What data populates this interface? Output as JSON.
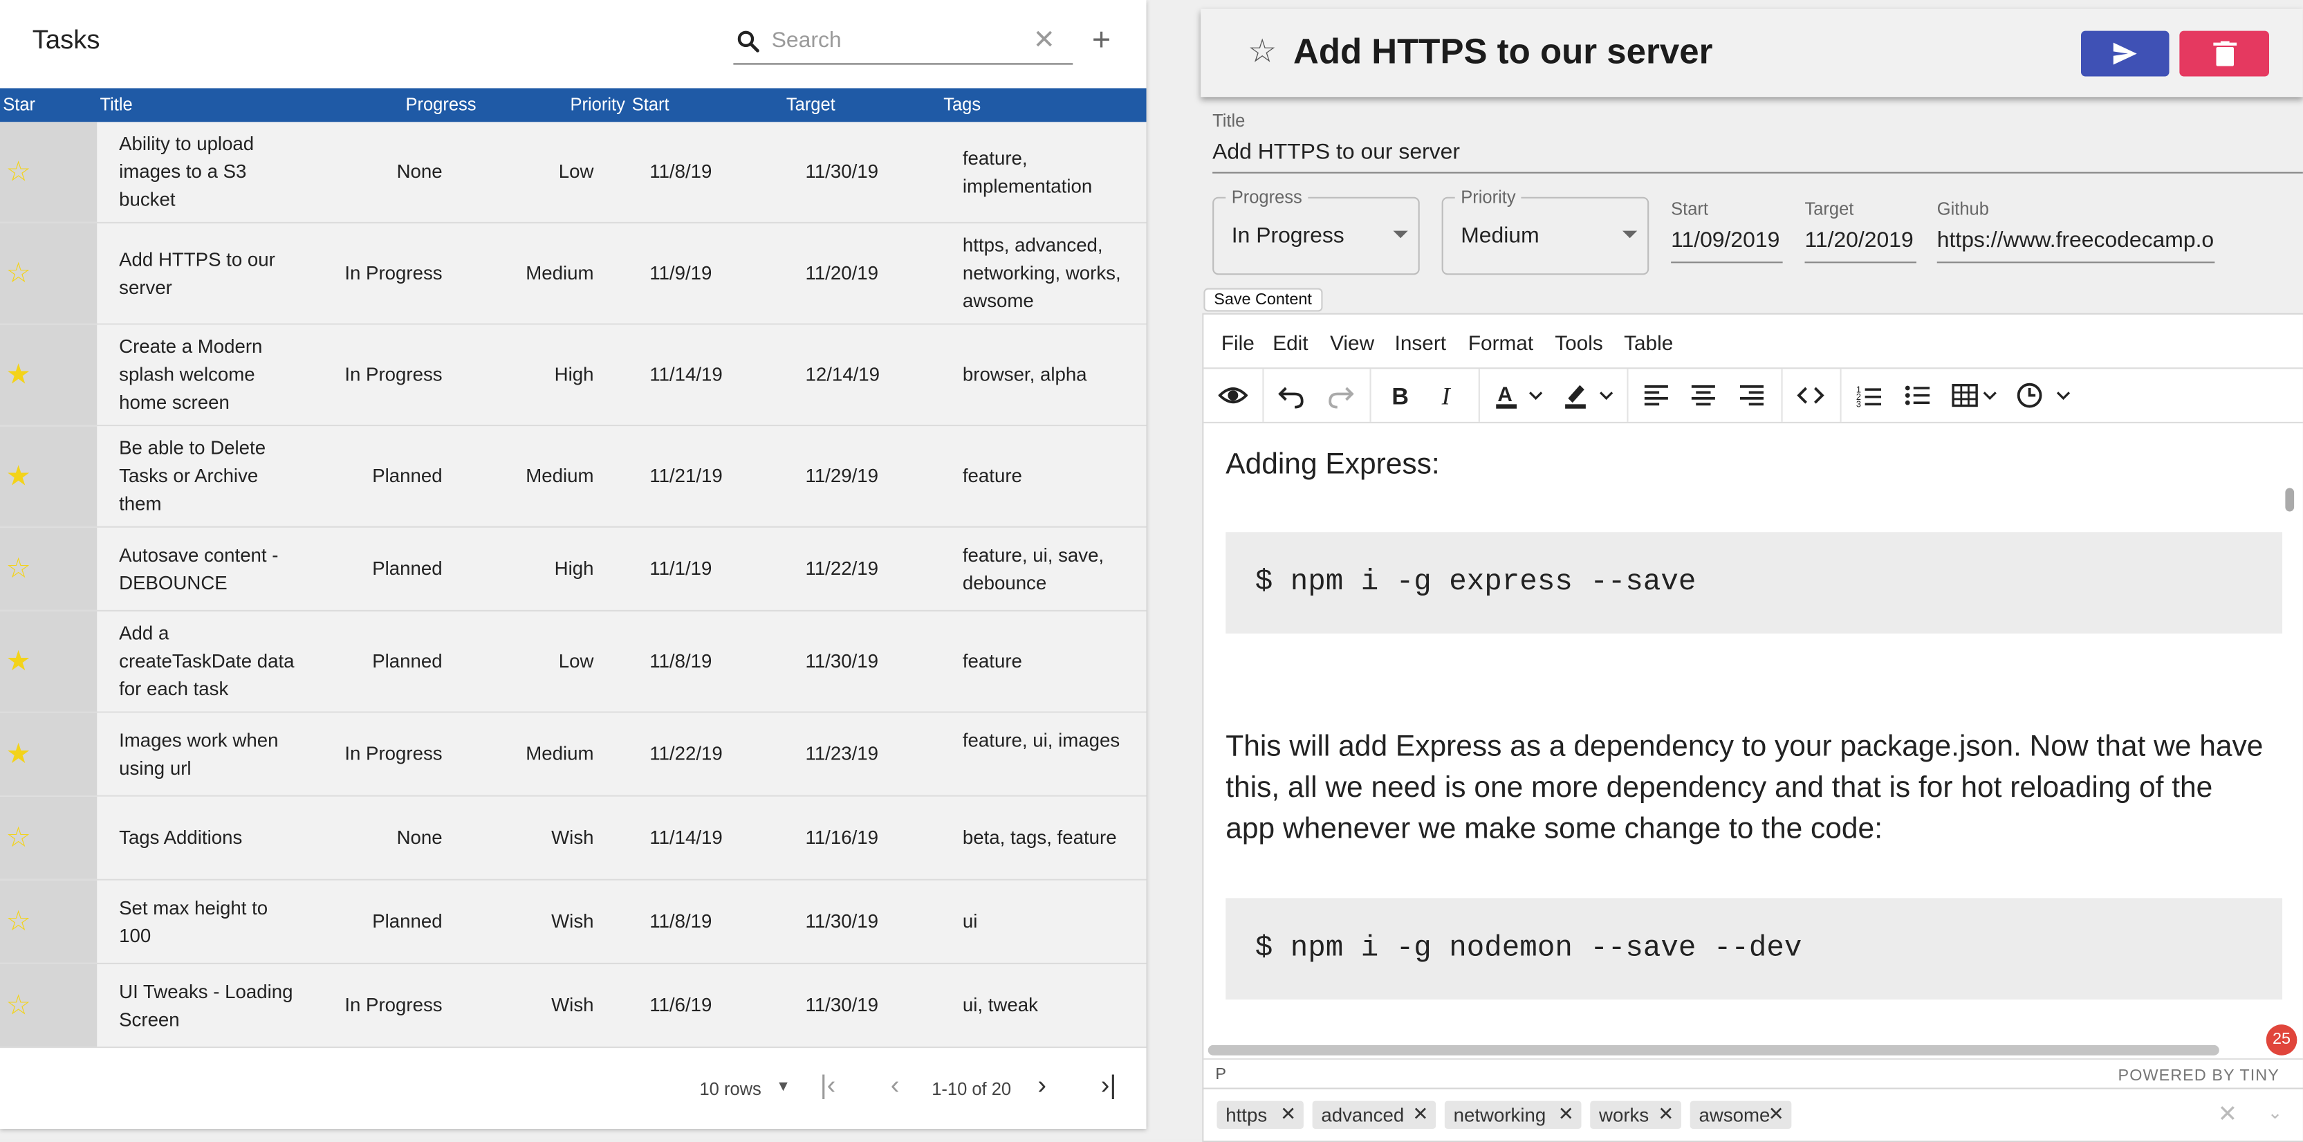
{
  "tasks_panel": {
    "title": "Tasks",
    "search_placeholder": "Search",
    "columns": [
      "Star",
      "Title",
      "Progress",
      "Priority",
      "Start",
      "Target",
      "Tags"
    ],
    "rows": [
      {
        "starred": false,
        "title": "Ability to upload images to a S3 bucket",
        "progress": "None",
        "priority": "Low",
        "start": "11/8/19",
        "target": "11/30/19",
        "tags": "feature, implementation"
      },
      {
        "starred": false,
        "title": "Add HTTPS to our server",
        "progress": "In Progress",
        "priority": "Medium",
        "start": "11/9/19",
        "target": "11/20/19",
        "tags": "https, advanced, networking, works, awsome"
      },
      {
        "starred": true,
        "title": "Create a Modern splash welcome home screen",
        "progress": "In Progress",
        "priority": "High",
        "start": "11/14/19",
        "target": "12/14/19",
        "tags": "browser, alpha"
      },
      {
        "starred": true,
        "title": "Be able to Delete Tasks or Archive them",
        "progress": "Planned",
        "priority": "Medium",
        "start": "11/21/19",
        "target": "11/29/19",
        "tags": "feature"
      },
      {
        "starred": false,
        "title": "Autosave content - DEBOUNCE",
        "progress": "Planned",
        "priority": "High",
        "start": "11/1/19",
        "target": "11/22/19",
        "tags": "feature, ui, save, debounce"
      },
      {
        "starred": true,
        "title": "Add a createTaskDate data for each task",
        "progress": "Planned",
        "priority": "Low",
        "start": "11/8/19",
        "target": "11/30/19",
        "tags": "feature"
      },
      {
        "starred": true,
        "title": "Images work when using url",
        "progress": "In Progress",
        "priority": "Medium",
        "start": "11/22/19",
        "target": "11/23/19",
        "tags": "feature, ui, images"
      },
      {
        "starred": false,
        "title": "Tags Additions",
        "progress": "None",
        "priority": "Wish",
        "start": "11/14/19",
        "target": "11/16/19",
        "tags": "beta, tags, feature"
      },
      {
        "starred": false,
        "title": "Set max height to 100",
        "progress": "Planned",
        "priority": "Wish",
        "start": "11/8/19",
        "target": "11/30/19",
        "tags": "ui"
      },
      {
        "starred": false,
        "title": "UI Tweaks - Loading Screen",
        "progress": "In Progress",
        "priority": "Wish",
        "start": "11/6/19",
        "target": "11/30/19",
        "tags": "ui, tweak"
      }
    ],
    "pagination": {
      "rows_per_page": "10 rows",
      "range": "1-10 of 20"
    }
  },
  "detail": {
    "heading": "Add HTTPS to our server",
    "title_label": "Title",
    "title_value": "Add HTTPS to our server",
    "progress_label": "Progress",
    "progress_value": "In Progress",
    "priority_label": "Priority",
    "priority_value": "Medium",
    "start_label": "Start",
    "start_value": "11/09/2019",
    "target_label": "Target",
    "target_value": "11/20/2019",
    "github_label": "Github",
    "github_value": "https://www.freecodecamp.o",
    "save_content": "Save Content"
  },
  "editor": {
    "menu": [
      "File",
      "Edit",
      "View",
      "Insert",
      "Format",
      "Tools",
      "Table"
    ],
    "toolbar_icons": [
      "preview-icon",
      "undo-icon",
      "redo-icon",
      "bold-icon",
      "italic-icon",
      "text-color-icon",
      "highlight-icon",
      "align-left-icon",
      "align-center-icon",
      "align-right-icon",
      "code-icon",
      "numbered-list-icon",
      "bullet-list-icon",
      "table-icon",
      "clock-icon"
    ],
    "content": {
      "heading": "Adding Express:",
      "code1": "$ npm i -g express --save",
      "paragraph": "This will add Express as a dependency to your package.json. Now that we have this, all we need is one more dependency and that is for hot reloading of the app whenever we make some change to the code:",
      "code2": "$ npm i -g nodemon --save --dev"
    },
    "status_path": "P",
    "powered_by": "POWERED BY TINY",
    "notification_count": "25"
  },
  "tags": [
    "https",
    "advanced",
    "networking",
    "works",
    "awsome"
  ],
  "colors": {
    "header_blue": "#1f5aa6",
    "send_button": "#3f51b5",
    "delete_button": "#e53960",
    "star_yellow": "#f3d31a"
  }
}
